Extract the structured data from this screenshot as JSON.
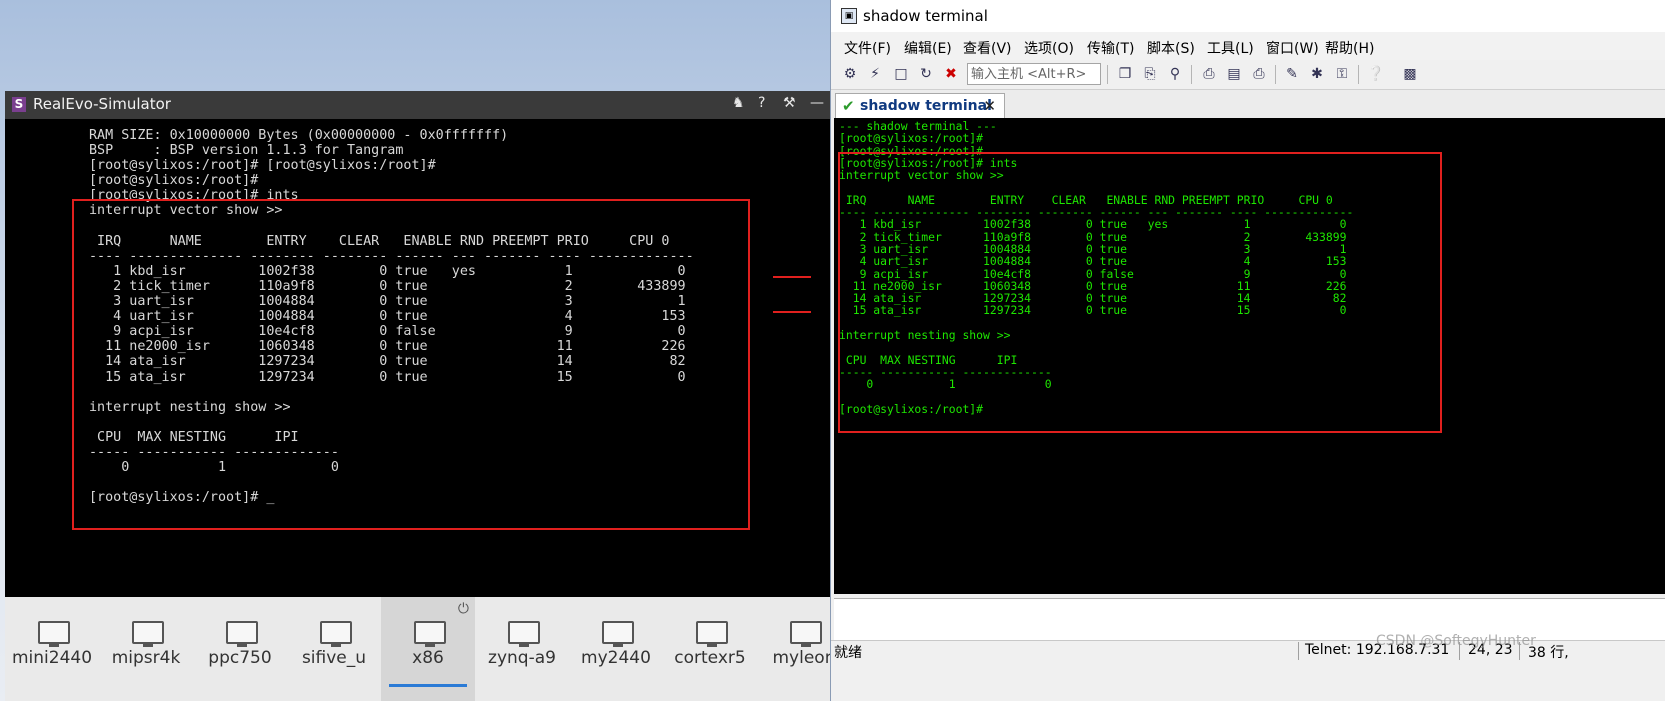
{
  "simulator": {
    "title": "RealEvo-Simulator",
    "logo_letter": "S",
    "controls": [
      "person-icon",
      "help-icon",
      "wrench-icon",
      "minimize-icon"
    ],
    "terminal_lines": [
      "RAM SIZE: 0x10000000 Bytes (0x00000000 - 0x0fffffff)",
      "BSP     : BSP version 1.1.3 for Tangram",
      "[root@sylixos:/root]# [root@sylixos:/root]#",
      "[root@sylixos:/root]#",
      "[root@sylixos:/root]# ints",
      "interrupt vector show >>",
      "",
      " IRQ      NAME        ENTRY    CLEAR   ENABLE RND PREEMPT PRIO     CPU 0",
      "---- -------------- -------- -------- ------ --- ------- ---- -------------",
      "   1 kbd_isr         1002f38        0 true   yes           1             0",
      "   2 tick_timer      110a9f8        0 true                 2        433899",
      "   3 uart_isr        1004884        0 true                 3             1",
      "   4 uart_isr        1004884        0 true                 4           153",
      "   9 acpi_isr        10e4cf8        0 false                9             0",
      "  11 ne2000_isr      1060348        0 true                11           226",
      "  14 ata_isr         1297234        0 true                14            82",
      "  15 ata_isr         1297234        0 true                15             0",
      "",
      "interrupt nesting show >>",
      "",
      " CPU  MAX NESTING      IPI",
      "----- ----------- -------------",
      "    0           1             0",
      "",
      "[root@sylixos:/root]# _"
    ],
    "dock": [
      {
        "label": "mini2440",
        "icon": "monitor-icon"
      },
      {
        "label": "mipsr4k",
        "icon": "monitor-icon"
      },
      {
        "label": "ppc750",
        "icon": "monitor-icon"
      },
      {
        "label": "sifive_u",
        "icon": "monitor-icon"
      },
      {
        "label": "x86",
        "icon": "monitor-icon",
        "active": true
      },
      {
        "label": "zynq-a9",
        "icon": "monitor-icon"
      },
      {
        "label": "my2440",
        "icon": "monitor-icon"
      },
      {
        "label": "cortexr5",
        "icon": "monitor-icon"
      },
      {
        "label": "myleon",
        "icon": "monitor-icon"
      }
    ],
    "power_glyph": "⏻"
  },
  "shadow": {
    "title": "shadow terminal",
    "menu": [
      "文件(F)",
      "编辑(E)",
      "查看(V)",
      "选项(O)",
      "传输(T)",
      "脚本(S)",
      "工具(L)",
      "窗口(W)",
      "帮助(H)"
    ],
    "host_input_placeholder": "输入主机 <Alt+R>",
    "tab_label": "shadow terminal",
    "terminal_lines": [
      "--- shadow terminal ---",
      "[root@sylixos:/root]#",
      "[root@sylixos:/root]#",
      "[root@sylixos:/root]# ints",
      "interrupt vector show >>",
      "",
      " IRQ      NAME        ENTRY    CLEAR   ENABLE RND PREEMPT PRIO     CPU 0",
      "---- -------------- -------- -------- ------ --- ------- ---- -------------",
      "   1 kbd_isr         1002f38        0 true   yes           1             0",
      "   2 tick_timer      110a9f8        0 true                 2        433899",
      "   3 uart_isr        1004884        0 true                 3             1",
      "   4 uart_isr        1004884        0 true                 4           153",
      "   9 acpi_isr        10e4cf8        0 false                9             0",
      "  11 ne2000_isr      1060348        0 true                11           226",
      "  14 ata_isr         1297234        0 true                14            82",
      "  15 ata_isr         1297234        0 true                15             0",
      "",
      "interrupt nesting show >>",
      "",
      " CPU  MAX NESTING      IPI",
      "----- ----------- -------------",
      "    0           1             0",
      "",
      "[root@sylixos:/root]#"
    ],
    "status": {
      "ready": "就绪",
      "connection": "Telnet: 192.168.7.31",
      "cursor": "24, 23",
      "rows": "38 行,"
    }
  },
  "watermark": "CSDN @SoftegyHunter",
  "colors": {
    "annotation_red": "#e0201e",
    "terminal_green": "#1ee600",
    "console_gray": "#d8d8d8"
  }
}
